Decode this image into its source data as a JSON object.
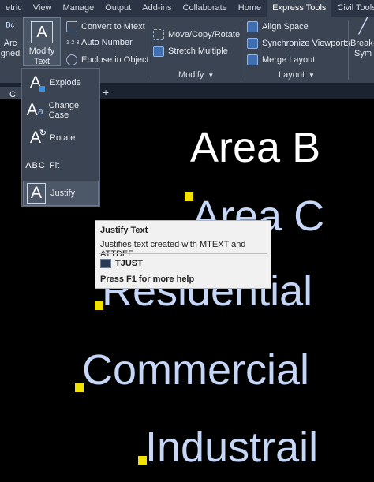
{
  "ribbon_tabs": [
    {
      "label": "etric"
    },
    {
      "label": "View"
    },
    {
      "label": "Manage"
    },
    {
      "label": "Output"
    },
    {
      "label": "Add-ins"
    },
    {
      "label": "Collaborate"
    },
    {
      "label": "Home"
    },
    {
      "label": "Express Tools",
      "active": true
    },
    {
      "label": "Civil Tools"
    }
  ],
  "ribbon": {
    "arc_aligned": {
      "line1": "Arc",
      "line2": "gned"
    },
    "modify_text": {
      "line1": "Modify",
      "line2": "Text"
    },
    "convert_to_mtext": "Convert to Mtext",
    "auto_number": "Auto Number",
    "enclose_in_object": "Enclose in Object",
    "move_copy_rotate": "Move/Copy/Rotate",
    "stretch_multiple": "Stretch Multiple",
    "modify_panel": "Modify",
    "align_space": "Align Space",
    "synchronize_viewports": "Synchronize Viewports",
    "merge_layout": "Merge Layout",
    "layout_panel": "Layout",
    "break_sym": {
      "line1": "Break-",
      "line2": "Sym"
    }
  },
  "dropdown_items": [
    {
      "label": "Explode",
      "icon": "explode-icon"
    },
    {
      "label": "Change Case",
      "icon": "change-case-icon"
    },
    {
      "label": "Rotate",
      "icon": "rotate-icon"
    },
    {
      "label": "Fit",
      "icon": "fit-icon"
    },
    {
      "label": "Justify",
      "icon": "justify-icon",
      "selected": true
    }
  ],
  "tooltip": {
    "title": "Justify Text",
    "description": "Justifies text created with MTEXT and ATTDEF",
    "command": "TJUST",
    "help": "Press F1 for more help"
  },
  "file_tab": {
    "partial_label": "C",
    "plus": "+"
  },
  "drawing_text": [
    {
      "text": "Area B",
      "color": "#ffffff"
    },
    {
      "text": "Area C",
      "color": "#c5d6f7"
    },
    {
      "text": "Residential",
      "color": "#c5d6f7"
    },
    {
      "text": "Commercial",
      "color": "#c5d6f7"
    },
    {
      "text": "Industrail",
      "color": "#c5d6f7"
    }
  ],
  "colors": {
    "grip": "#f2e200",
    "ribbon": "#3b4453",
    "tabs": "#2b3444"
  }
}
